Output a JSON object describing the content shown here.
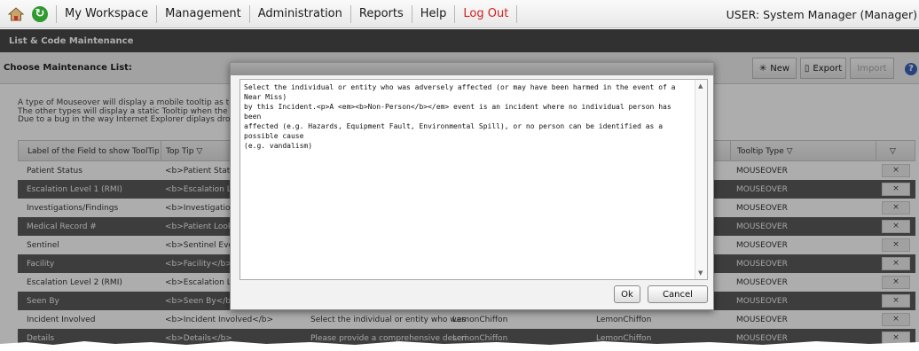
{
  "menubar": {
    "items": [
      "My Workspace",
      "Management",
      "Administration",
      "Reports",
      "Help",
      "Log Out"
    ],
    "user": "USER: System Manager (Manager)"
  },
  "page": {
    "title": "List & Code Maintenance",
    "choose_label": "Choose Maintenance List:"
  },
  "toolbar": {
    "new_label": "New",
    "export_label": "Export",
    "import_label": "Import"
  },
  "info_lines": [
    "A type of Mouseover will display a mobile tooltip as t",
    "The other types will display a static Tooltip when the",
    "Due to a bug in the way Internet Explorer diplays dro"
  ],
  "grid": {
    "headers": [
      "Label of the Field to show ToolTip o",
      "Top Tip",
      "Tooltip Type"
    ],
    "rows": [
      {
        "label": "Patient Status",
        "tip": "<b>Patient Statu",
        "desc": "",
        "color1": "",
        "color2": "",
        "type": "MOUSEOVER"
      },
      {
        "label": "Escalation Level 1 (RMI)",
        "tip": "<b>Escalation Lev",
        "desc": "",
        "color1": "",
        "color2": "",
        "type": "MOUSEOVER"
      },
      {
        "label": "Investigations/Findings",
        "tip": "<b>Investigations",
        "desc": "",
        "color1": "",
        "color2": "",
        "type": "MOUSEOVER"
      },
      {
        "label": "Medical Record #",
        "tip": "<b>Patient Looku",
        "desc": "",
        "color1": "",
        "color2": "",
        "type": "MOUSEOVER"
      },
      {
        "label": "Sentinel",
        "tip": "<b>Sentinel Event",
        "desc": "",
        "color1": "",
        "color2": "",
        "type": "MOUSEOVER"
      },
      {
        "label": "Facility",
        "tip": "<b>Facility</b>",
        "desc": "",
        "color1": "",
        "color2": "",
        "type": "MOUSEOVER"
      },
      {
        "label": "Escalation Level 2 (RMI)",
        "tip": "<b>Escalation Lev",
        "desc": "",
        "color1": "",
        "color2": "",
        "type": "MOUSEOVER"
      },
      {
        "label": "Seen By",
        "tip": "<b>Seen By</b>",
        "desc": "",
        "color1": "",
        "color2": "",
        "type": "MOUSEOVER"
      },
      {
        "label": "Incident Involved",
        "tip": "<b>Incident Involved</b>",
        "desc": "Select the individual or entity who was",
        "color1": "LemonChiffon",
        "color2": "LemonChiffon",
        "type": "MOUSEOVER"
      },
      {
        "label": "Details",
        "tip": "<b>Details</b>",
        "desc": "Please provide a comprehensive descri",
        "color1": "LemonChiffon",
        "color2": "LemonChiffon",
        "type": "MOUSEOVER"
      }
    ],
    "row_action": "×"
  },
  "modal": {
    "text": "Select the individual or entity who was adversely affected (or may have been harmed in the event of a Near Miss)\nby this Incident.<p>A <em><b>Non-Person</b></em> event is an incident where no individual person has been\naffected (e.g. Hazards, Equipment Fault, Environmental Spill), or no person can be identified as a possible cause\n(e.g. vandalism)",
    "ok_label": "Ok",
    "cancel_label": "Cancel"
  },
  "colors": {
    "title_bar": "#494949",
    "dark_row": "#5a5a5a",
    "logout": "#d42020",
    "refresh": "#2f9a2f"
  },
  "icons": [
    "home-icon",
    "refresh-icon",
    "new-icon",
    "export-icon",
    "help-icon",
    "filter-icon",
    "close-icon",
    "scroll-up-icon",
    "scroll-down-icon"
  ]
}
